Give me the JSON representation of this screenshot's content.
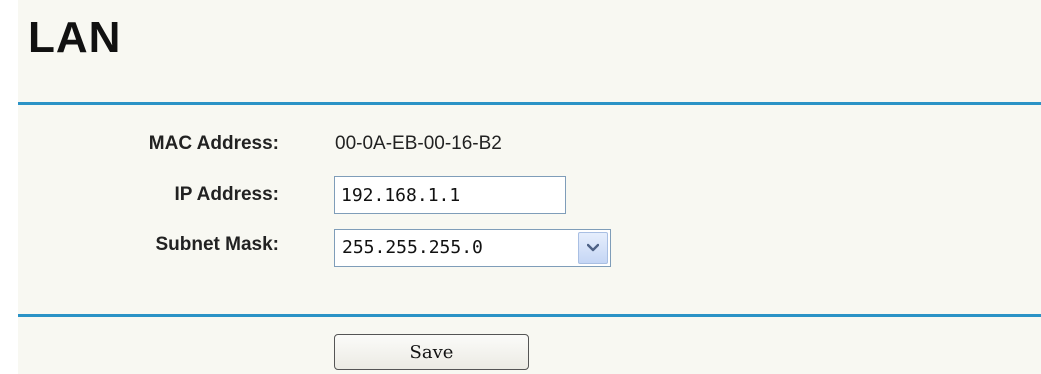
{
  "page": {
    "title": "LAN"
  },
  "form": {
    "mac_label": "MAC Address:",
    "mac_value": "00-0A-EB-00-16-B2",
    "ip_label": "IP Address:",
    "ip_value": "192.168.1.1",
    "mask_label": "Subnet Mask:",
    "mask_value": "255.255.255.0",
    "mask_arrow_icon": "chevron-down-icon"
  },
  "actions": {
    "save_label": "Save"
  },
  "colors": {
    "panel_background": "#f8f8f2",
    "divider": "#2b93c6",
    "input_border": "#7f9db9"
  }
}
